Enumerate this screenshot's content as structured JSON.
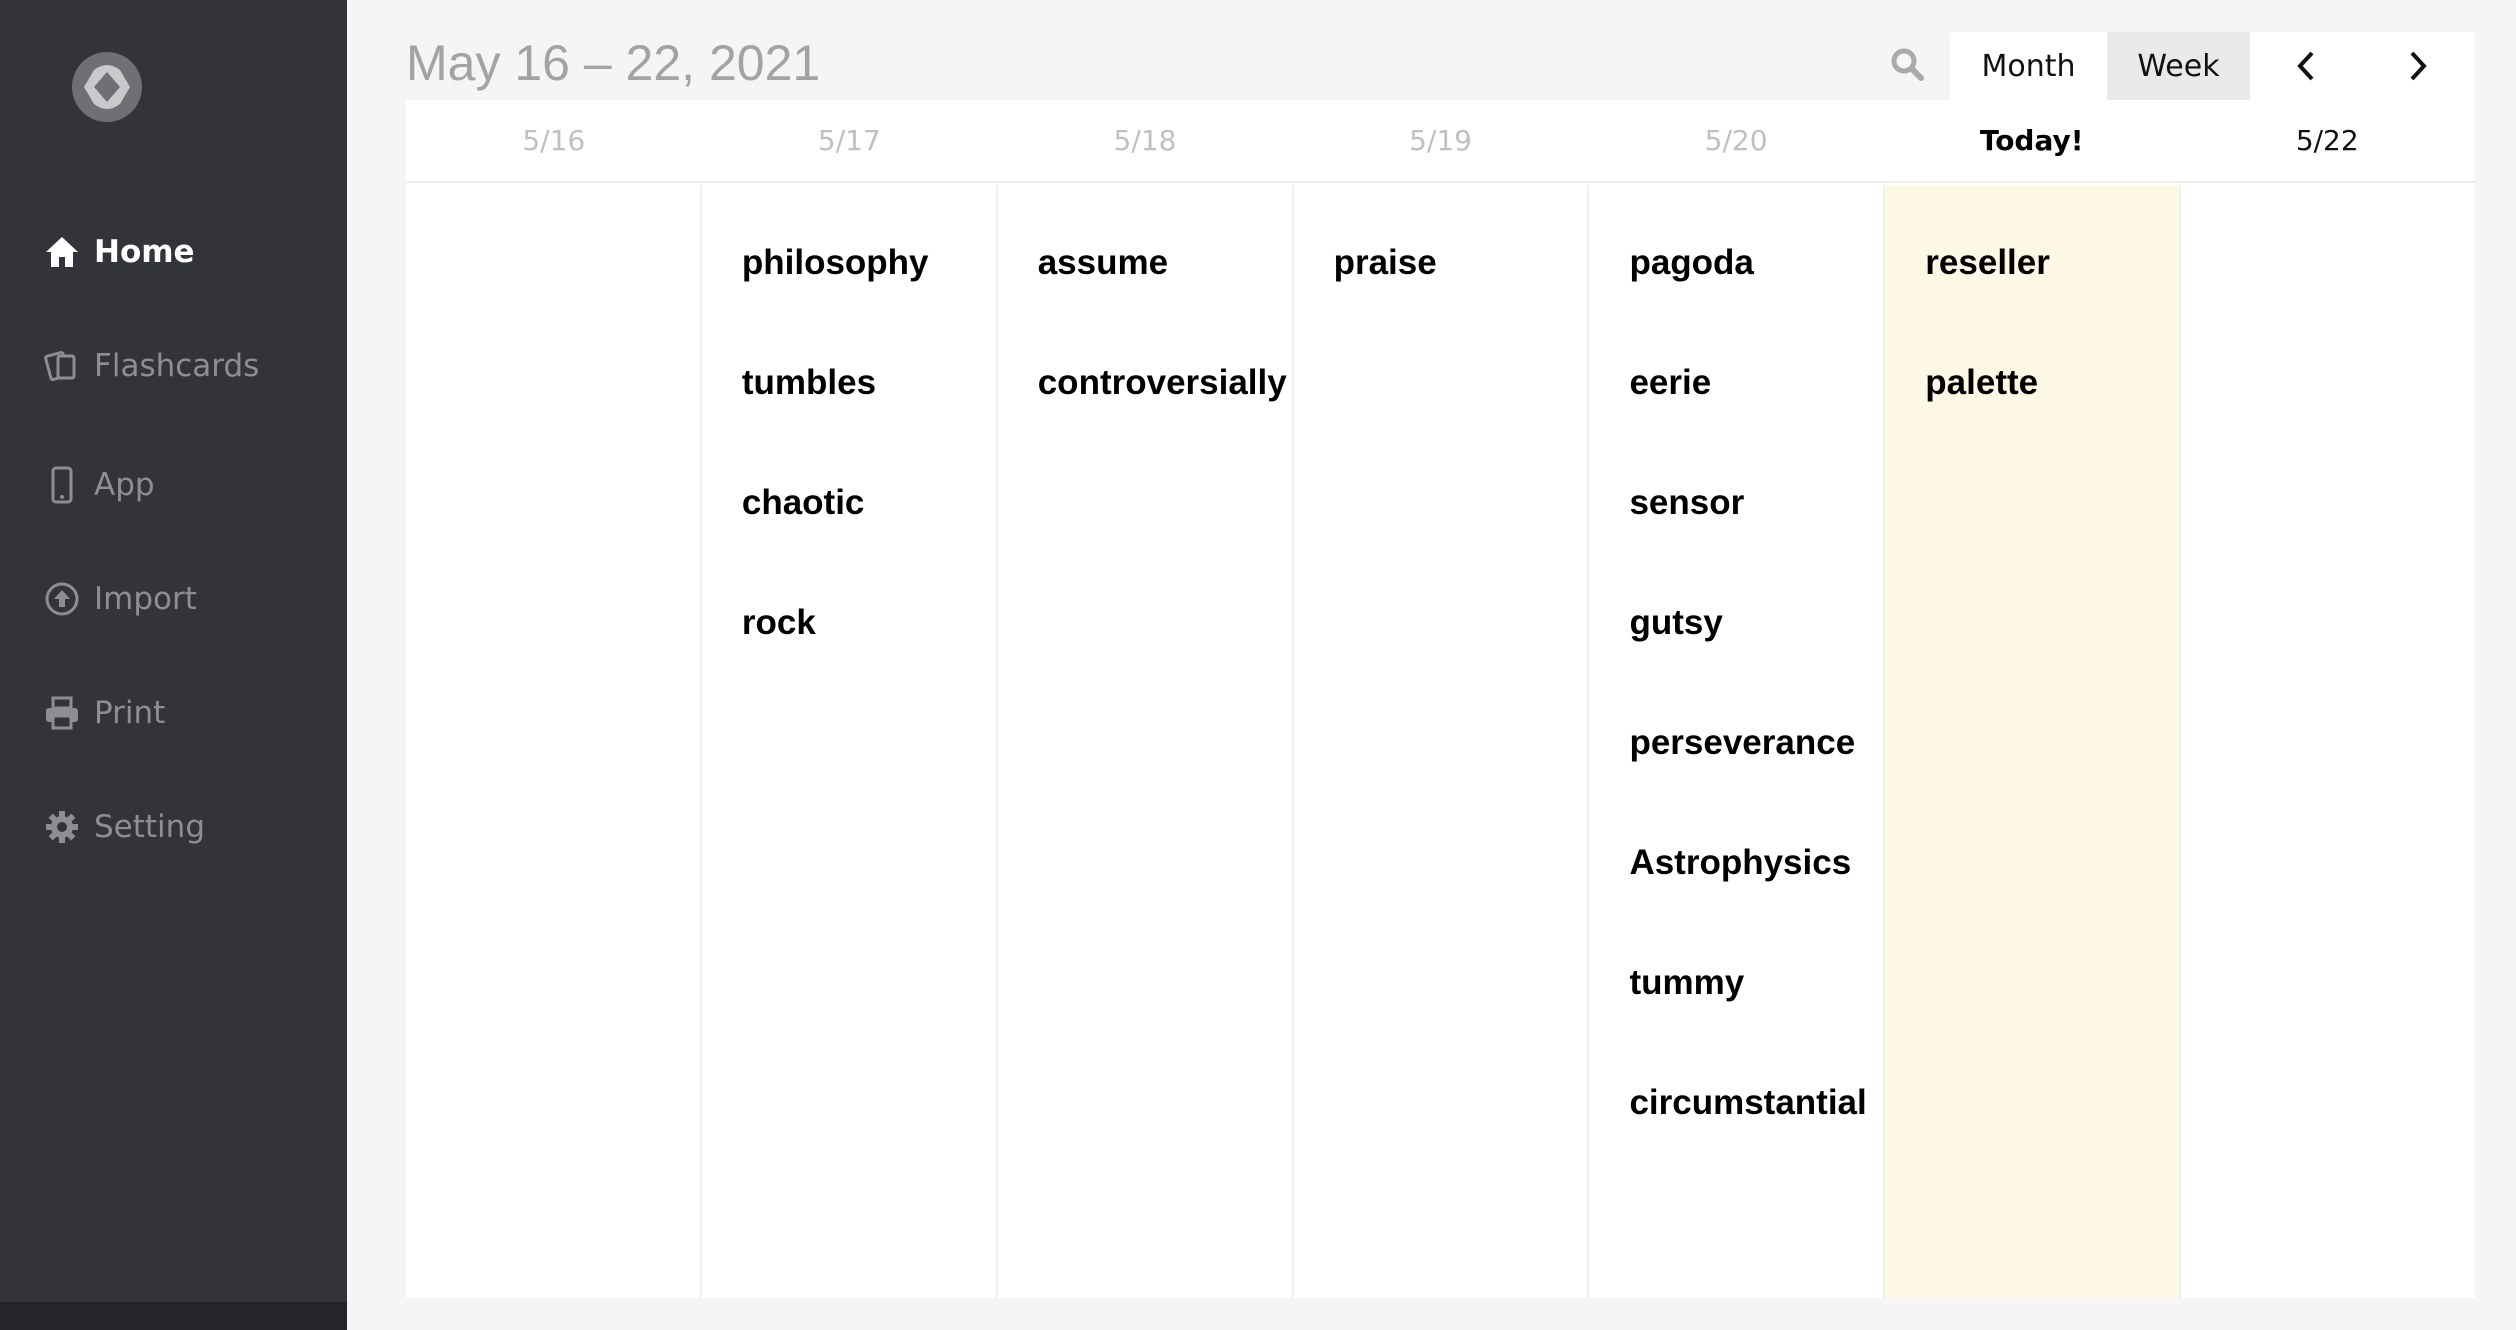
{
  "sidebar": {
    "logo": "app-logo",
    "items": [
      {
        "label": "Home",
        "icon": "home-icon",
        "active": true
      },
      {
        "label": "Flashcards",
        "icon": "flashcards-icon"
      },
      {
        "label": "App",
        "icon": "mobile-icon"
      },
      {
        "label": "Import",
        "icon": "upload-icon"
      },
      {
        "label": "Print",
        "icon": "printer-icon"
      },
      {
        "label": "Setting",
        "icon": "gear-icon"
      }
    ]
  },
  "header": {
    "title": "May 16 – 22, 2021",
    "month_label": "Month",
    "week_label": "Week",
    "active_view": "Week"
  },
  "calendar": {
    "days": [
      {
        "label": "5/16",
        "words": []
      },
      {
        "label": "5/17",
        "words": [
          "philosophy",
          "tumbles",
          "chaotic",
          "rock"
        ]
      },
      {
        "label": "5/18",
        "words": [
          "assume",
          "controversially"
        ]
      },
      {
        "label": "5/19",
        "words": [
          "praise"
        ]
      },
      {
        "label": "5/20",
        "words": [
          "pagoda",
          "eerie",
          "sensor",
          "gutsy",
          "perseverance",
          "Astrophysics",
          "tummy",
          "circumstantial"
        ]
      },
      {
        "label": "Today!",
        "words": [
          "reseller",
          "palette"
        ],
        "today": true
      },
      {
        "label": "5/22",
        "words": []
      }
    ]
  },
  "colors": {
    "sidebar": "#33343a",
    "today_highlight": "#fdf8e4"
  }
}
